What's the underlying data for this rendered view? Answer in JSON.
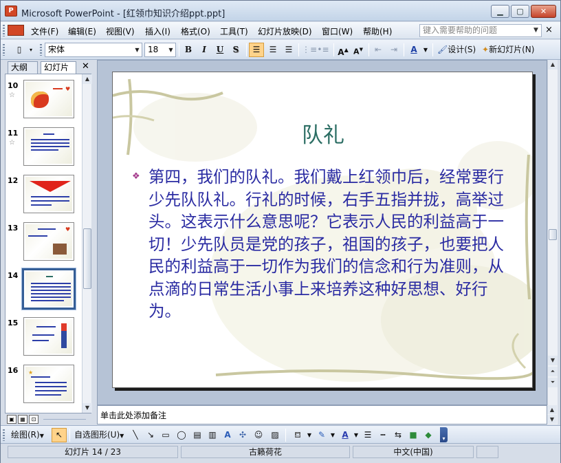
{
  "window": {
    "app_icon_label": "P",
    "title": "Microsoft PowerPoint - [红领巾知识介绍ppt.ppt]",
    "min_label": "▭",
    "max_label": "☐",
    "close_label": "✕"
  },
  "menubar": {
    "items": [
      "文件(F)",
      "编辑(E)",
      "视图(V)",
      "插入(I)",
      "格式(O)",
      "工具(T)",
      "幻灯片放映(D)",
      "窗口(W)",
      "帮助(H)"
    ],
    "help_placeholder": "键入需要帮助的问题",
    "close_doc": "×"
  },
  "toolbar": {
    "font_name": "宋体",
    "font_size": "18",
    "bold": "B",
    "italic": "I",
    "underline": "U",
    "shadow": "S",
    "font_color": "A",
    "design_label": "设计(S)",
    "new_slide_label": "新幻灯片(N)"
  },
  "slide_pane": {
    "tab_outline": "大纲",
    "tab_slides": "幻灯片",
    "close": "✕",
    "thumbs": [
      {
        "num": "10",
        "star": "☆",
        "selected": false,
        "style": "title-star"
      },
      {
        "num": "11",
        "star": "☆",
        "selected": false,
        "style": "text"
      },
      {
        "num": "12",
        "star": "",
        "selected": false,
        "style": "red-arrow"
      },
      {
        "num": "13",
        "star": "",
        "selected": false,
        "style": "photo"
      },
      {
        "num": "14",
        "star": "",
        "selected": true,
        "style": "text"
      },
      {
        "num": "15",
        "star": "",
        "selected": false,
        "style": "figure"
      },
      {
        "num": "16",
        "star": "",
        "selected": false,
        "style": "text-list"
      }
    ]
  },
  "slide": {
    "title": "队礼",
    "bullet": "❖",
    "body": "第四，我们的队礼。我们戴上红领巾后，经常要行少先队队礼。行礼的时候，右手五指并拢，高举过头。这表示什么意思呢？它表示人民的利益高于一切！少先队员是党的孩子，祖国的孩子，也要把人民的利益高于一切作为我们的信念和行为准则，从点滴的日常生活小事上来培养这种好思想、好行为。"
  },
  "notes": {
    "placeholder": "单击此处添加备注"
  },
  "drawbar": {
    "draw_label": "绘图(R)",
    "autoshape_label": "自选图形(U)"
  },
  "status": {
    "slide_pos": "幻灯片 14 / 23",
    "template": "古籁荷花",
    "language": "中文(中国)"
  },
  "colors": {
    "title_color": "#2c6e64",
    "body_color": "#2a2ba2",
    "bullet_color": "#a3388a"
  }
}
